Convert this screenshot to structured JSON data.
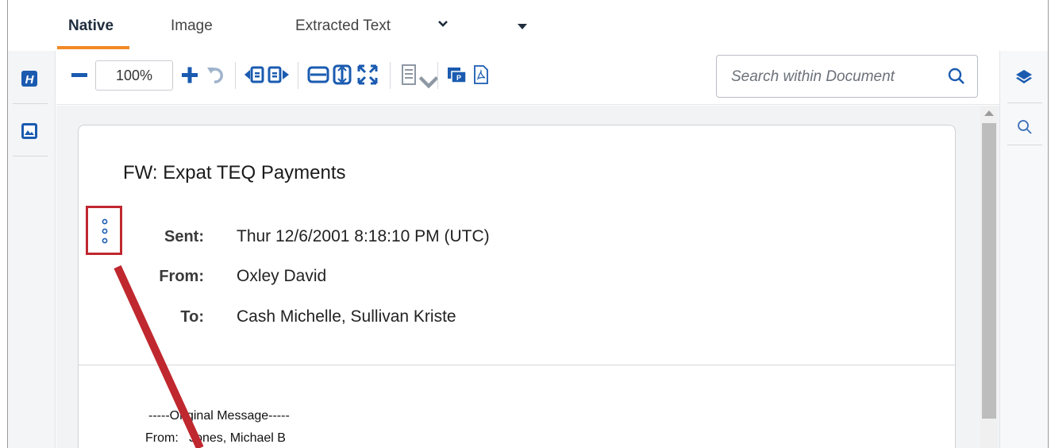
{
  "tabs": [
    {
      "label": "Native"
    },
    {
      "label": "Image"
    },
    {
      "label": "Extracted Text"
    }
  ],
  "toolbar": {
    "zoom_value": "100%",
    "search_placeholder": "Search within Document"
  },
  "document": {
    "subject": "FW: Expat TEQ Payments",
    "headers": [
      {
        "label": "Sent:",
        "value": "Thur 12/6/2001 8:18:10 PM (UTC)"
      },
      {
        "label": "From:",
        "value": "Oxley David"
      },
      {
        "label": "To:",
        "value": "Cash Michelle, Sullivan Kriste"
      }
    ],
    "body_lines": [
      "-----Original Message-----",
      "From:   Jones, Michael B"
    ]
  },
  "colors": {
    "accent": "#f08a24",
    "icon_blue": "#1a5bb0",
    "highlight_red": "#c0282f"
  },
  "icons": {
    "left_rail": [
      "highlight-icon",
      "image-icon"
    ],
    "right_rail": [
      "layers-icon",
      "search-icon"
    ],
    "toolbar": [
      "zoom-out-icon",
      "zoom-in-icon",
      "rotate-icon",
      "page-prev-icon",
      "page-next-icon",
      "fit-width-icon",
      "fit-height-icon",
      "fullscreen-icon",
      "print-icon",
      "export-icon",
      "pdf-icon"
    ]
  }
}
